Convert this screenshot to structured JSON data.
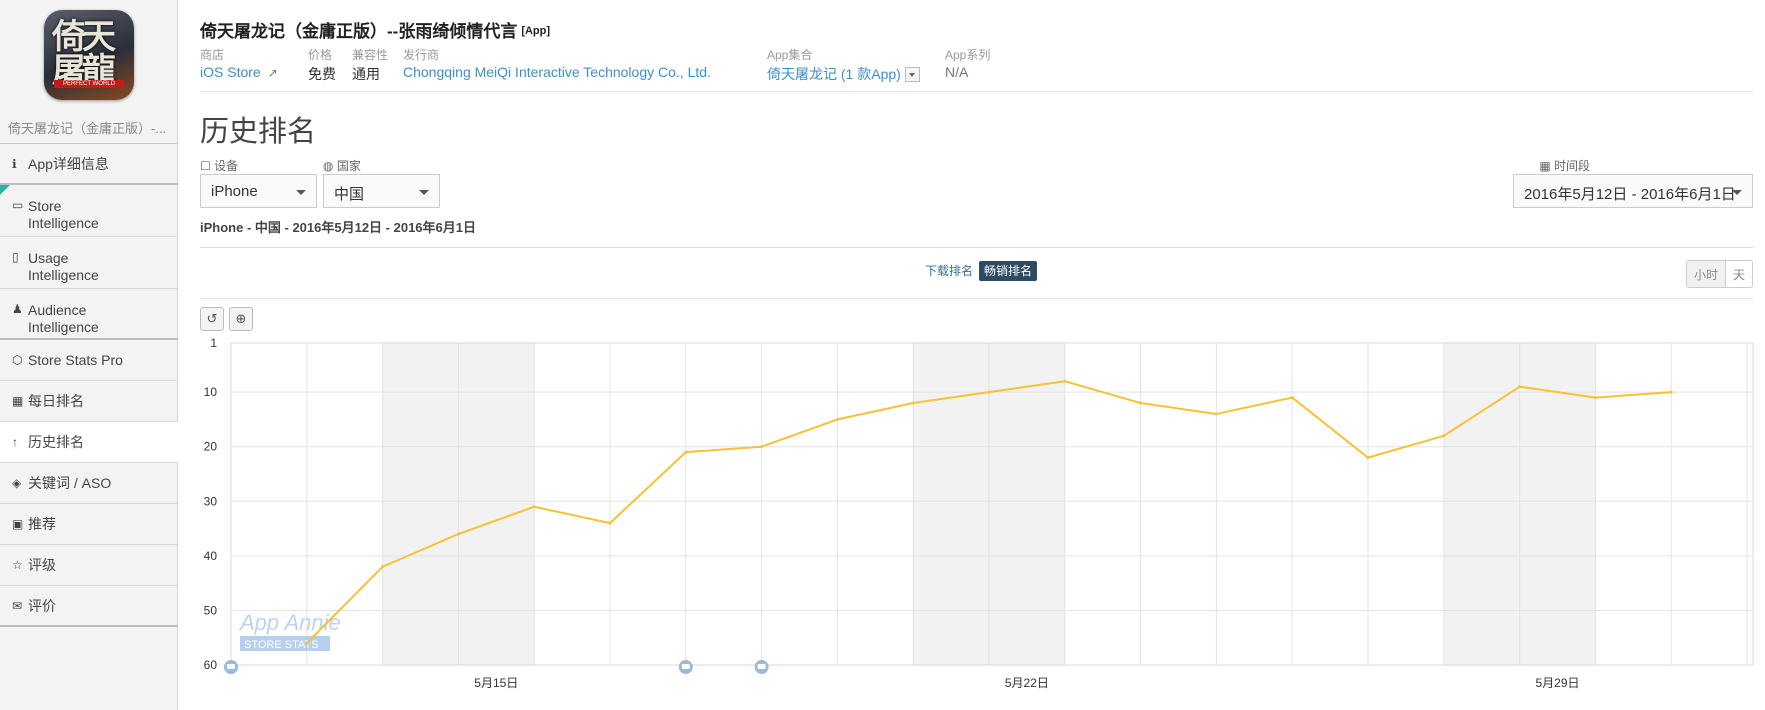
{
  "app": {
    "name": "倚天屠龙记（金庸正版）--张雨绮倾情代言",
    "type_tag": "[App]",
    "short_name": "倚天屠龙记（金庸正版）-...",
    "icon_text": "倚天屠龍",
    "icon_band": "PERFECT WORLD"
  },
  "meta": {
    "store_label": "商店",
    "store_value": "iOS Store",
    "price_label": "价格",
    "price_value": "免费",
    "compat_label": "兼容性",
    "compat_value": "通用",
    "publisher_label": "发行商",
    "publisher_value": "Chongqing MeiQi Interactive Technology Co., Ltd.",
    "collection_label": "App集合",
    "collection_value": "倚天屠龙记 (1 款App)",
    "series_label": "App系列",
    "series_value": "N/A"
  },
  "sidebar": {
    "items": [
      {
        "icon": "ℹ",
        "label": "App详细信息"
      },
      {
        "icon": "▭",
        "label": "Store Intelligence"
      },
      {
        "icon": "▯",
        "label": "Usage Intelligence"
      },
      {
        "icon": "♟",
        "label": "Audience Intelligence"
      },
      {
        "icon": "⬡",
        "label": "Store Stats Pro"
      },
      {
        "icon": "▦",
        "label": "每日排名"
      },
      {
        "icon": "↑",
        "label": "历史排名"
      },
      {
        "icon": "◈",
        "label": "关键词 / ASO"
      },
      {
        "icon": "▣",
        "label": "推荐"
      },
      {
        "icon": "☆",
        "label": "评级"
      },
      {
        "icon": "✉",
        "label": "评价"
      }
    ]
  },
  "page": {
    "heading": "历史排名",
    "device_label": "设备",
    "device_value": "iPhone",
    "country_label": "国家",
    "country_value": "中国",
    "period_label": "时间段",
    "period_value": "2016年5月12日 - 2016年6月1日",
    "summary": "iPhone - 中国 - 2016年5月12日 - 2016年6月1日",
    "tab_download": "下载排名",
    "tab_grossing": "畅销排名",
    "toggle_hour": "小时",
    "toggle_day": "天",
    "watermark_1": "App Annie",
    "watermark_2": "STORE STATS"
  },
  "icons": {
    "reset": "↺",
    "zoom": "⊕"
  },
  "chart_data": {
    "type": "line",
    "title": "",
    "xlabel": "",
    "ylabel": "",
    "ylim": [
      60,
      1
    ],
    "y_inverted": true,
    "yticks": [
      1,
      10,
      20,
      30,
      40,
      50,
      60
    ],
    "x_ticklabels": [
      {
        "date": "2016-05-15",
        "label": "5月15日"
      },
      {
        "date": "2016-05-22",
        "label": "5月22日"
      },
      {
        "date": "2016-05-29",
        "label": "5月29日"
      }
    ],
    "weekend_shading": [
      [
        "2016-05-14",
        "2016-05-15"
      ],
      [
        "2016-05-21",
        "2016-05-22"
      ],
      [
        "2016-05-28",
        "2016-05-29"
      ]
    ],
    "grid": true,
    "series": [
      {
        "color": "#f6c234",
        "x": [
          "2016-05-13",
          "2016-05-14",
          "2016-05-15",
          "2016-05-16",
          "2016-05-17",
          "2016-05-18",
          "2016-05-19",
          "2016-05-20",
          "2016-05-21",
          "2016-05-22",
          "2016-05-23",
          "2016-05-24",
          "2016-05-25",
          "2016-05-26",
          "2016-05-27",
          "2016-05-28",
          "2016-05-29",
          "2016-05-30",
          "2016-05-31"
        ],
        "values": [
          56,
          42,
          36,
          31,
          34,
          21,
          20,
          15,
          12,
          10,
          8,
          12,
          14,
          11,
          22,
          18,
          9,
          11,
          10
        ]
      }
    ],
    "annotation_dates": [
      "2016-05-12",
      "2016-05-18",
      "2016-05-19"
    ]
  }
}
